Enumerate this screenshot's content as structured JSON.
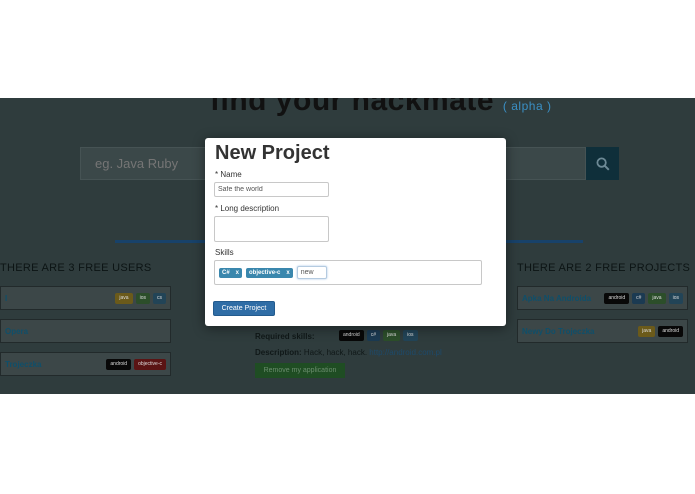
{
  "hero": {
    "title": "find your hackmate",
    "alpha": "( alpha )"
  },
  "search": {
    "placeholder": "eg. Java Ruby"
  },
  "users_section": {
    "title": "THERE ARE 3 FREE USERS",
    "items": [
      {
        "name": "I",
        "tags": [
          "java",
          "ios",
          "cs"
        ]
      },
      {
        "name": "Opera",
        "tags": []
      },
      {
        "name": "Trojeczka",
        "tags": [
          "android",
          "objective-c"
        ]
      }
    ]
  },
  "projects_section": {
    "title": "THERE ARE 2 FREE PROJECTS",
    "items": [
      {
        "name": "Apka Na Androida",
        "tags": [
          "android",
          "c#",
          "java",
          "ios"
        ]
      },
      {
        "name": "Newy Do Trojeczka",
        "tags": [
          "java",
          "android"
        ]
      }
    ]
  },
  "project_detail": {
    "required_label": "Required skills:",
    "required_tags": [
      "android",
      "c#",
      "java",
      "ios"
    ],
    "description_label": "Description:",
    "description_text": "Hack, hack, hack.",
    "description_link": "http://android.com.pl",
    "remove_label": "Remove my application"
  },
  "modal": {
    "title": "New Project",
    "name_label": "* Name",
    "name_value": "Safe the world",
    "desc_label": "* Long description",
    "skills_label": "Skills",
    "skills": [
      "C#",
      "objective-c"
    ],
    "skill_remove": "x",
    "skill_input_value": "new",
    "create_label": "Create Project"
  },
  "colors": {
    "accent": "#2f6da6",
    "chip": "#3a87ad",
    "overlay": "#2f3c3d"
  }
}
